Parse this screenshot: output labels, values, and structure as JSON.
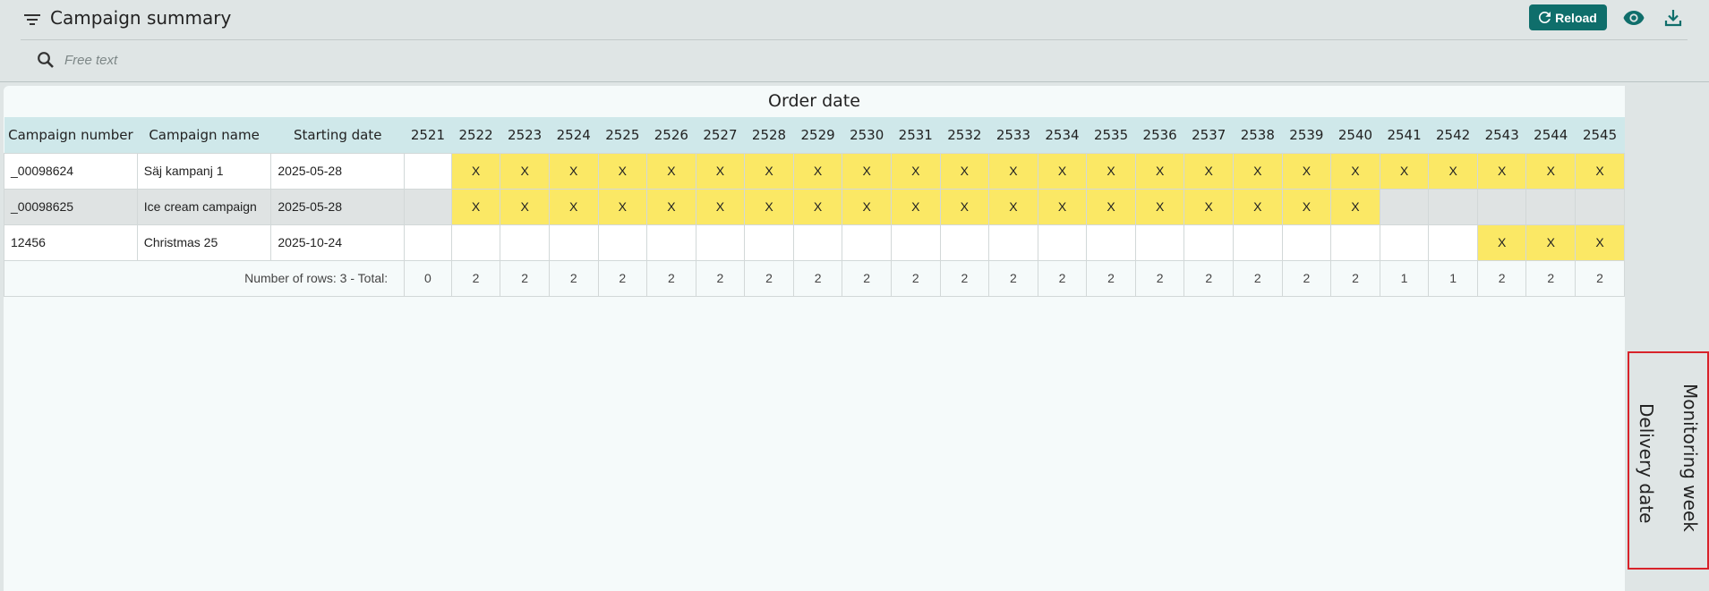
{
  "header": {
    "title": "Campaign summary",
    "reload_label": "Reload",
    "search_placeholder": "Free text"
  },
  "colors": {
    "accent": "#0f6e6b",
    "mark": "#fbe865",
    "header_row": "#cfe8ea",
    "highlight": "#d8232a"
  },
  "icons": {
    "filter": "filter-list-icon",
    "reload": "refresh-icon",
    "view": "eye-icon",
    "download": "download-icon",
    "search": "search-icon"
  },
  "table": {
    "group_title": "Order date",
    "columns": [
      "Campaign number",
      "Campaign name",
      "Starting date"
    ],
    "weeks": [
      "2521",
      "2522",
      "2523",
      "2524",
      "2525",
      "2526",
      "2527",
      "2528",
      "2529",
      "2530",
      "2531",
      "2532",
      "2533",
      "2534",
      "2535",
      "2536",
      "2537",
      "2538",
      "2539",
      "2540",
      "2541",
      "2542",
      "2543",
      "2544",
      "2545"
    ],
    "rows": [
      {
        "number": "_00098624",
        "name": "Säj kampanj 1",
        "start": "2025-05-28",
        "marks": [
          "",
          "X",
          "X",
          "X",
          "X",
          "X",
          "X",
          "X",
          "X",
          "X",
          "X",
          "X",
          "X",
          "X",
          "X",
          "X",
          "X",
          "X",
          "X",
          "X",
          "X",
          "X",
          "X",
          "X",
          "X"
        ]
      },
      {
        "number": "_00098625",
        "name": "Ice cream campaign",
        "start": "2025-05-28",
        "marks": [
          "",
          "X",
          "X",
          "X",
          "X",
          "X",
          "X",
          "X",
          "X",
          "X",
          "X",
          "X",
          "X",
          "X",
          "X",
          "X",
          "X",
          "X",
          "X",
          "X",
          "",
          "",
          "",
          "",
          ""
        ]
      },
      {
        "number": "12456",
        "name": "Christmas 25",
        "start": "2025-10-24",
        "marks": [
          "",
          "",
          "",
          "",
          "",
          "",
          "",
          "",
          "",
          "",
          "",
          "",
          "",
          "",
          "",
          "",
          "",
          "",
          "",
          "",
          "",
          "",
          "X",
          "X",
          "X"
        ]
      }
    ],
    "total_label": "Number of rows: 3  -  Total:",
    "totals": [
      "0",
      "2",
      "2",
      "2",
      "2",
      "2",
      "2",
      "2",
      "2",
      "2",
      "2",
      "2",
      "2",
      "2",
      "2",
      "2",
      "2",
      "2",
      "2",
      "2",
      "1",
      "1",
      "2",
      "2",
      "2"
    ]
  },
  "side_tabs": {
    "delivery": "Delivery date",
    "monitoring": "Monitoring week"
  }
}
